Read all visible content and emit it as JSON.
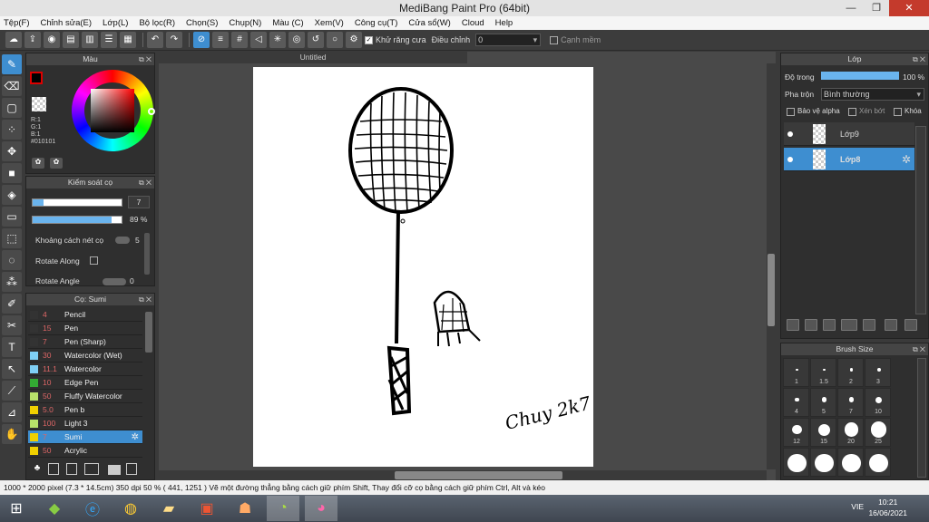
{
  "window": {
    "title": "MediBang Paint Pro (64bit)",
    "min": "—",
    "max": "❐",
    "close": "✕"
  },
  "menu": [
    "Tệp(F)",
    "Chỉnh sửa(E)",
    "Lớp(L)",
    "Bộ lọc(R)",
    "Chọn(S)",
    "Chụp(N)",
    "Màu (C)",
    "Xem(V)",
    "Công cụ(T)",
    "Cửa sổ(W)",
    "Cloud",
    "Help"
  ],
  "toolbar": {
    "antialias_label": "Khử răng cưa",
    "adjust_label": "Điều chỉnh",
    "adjust_value": "0",
    "smooth_label": "Cạnh mềm"
  },
  "color_panel": {
    "title": "Màu",
    "r": "R:1",
    "g": "G:1",
    "b": "B:1",
    "hex": "#010101"
  },
  "brush_control": {
    "title": "Kiểm soát cọ",
    "size_value": "7",
    "opacity_value": "89 %",
    "opacity_fraction": 0.89,
    "spacing_label": "Khoảng cách nét cọ",
    "spacing_value": "5",
    "rotate_along_label": "Rotate Along",
    "rotate_angle_label": "Rotate Angle",
    "rotate_angle_value": "0"
  },
  "brush_list": {
    "title": "Cọ: Sumi",
    "items": [
      {
        "size": "4",
        "name": "Pencil",
        "color": "#333333"
      },
      {
        "size": "15",
        "name": "Pen",
        "color": "#333333"
      },
      {
        "size": "7",
        "name": "Pen (Sharp)",
        "color": "#333333"
      },
      {
        "size": "30",
        "name": "Watercolor (Wet)",
        "color": "#7fd0f5"
      },
      {
        "size": "11.1",
        "name": "Watercolor",
        "color": "#7fd0f5"
      },
      {
        "size": "10",
        "name": "Edge Pen",
        "color": "#33aa33"
      },
      {
        "size": "50",
        "name": "Fluffy Watercolor",
        "color": "#b8e26a"
      },
      {
        "size": "5.0",
        "name": "Pen b",
        "color": "#f0d000"
      },
      {
        "size": "100",
        "name": "Light 3",
        "color": "#b8e26a"
      },
      {
        "size": "7",
        "name": "Sumi",
        "color": "#f0d000"
      },
      {
        "size": "50",
        "name": "Acrylic",
        "color": "#f0d000"
      }
    ]
  },
  "canvas": {
    "tab": "Untitled",
    "signature": "Chuy 2k7"
  },
  "layer_panel": {
    "title": "Lớp",
    "opacity_label": "Độ trong",
    "opacity_value": "100 %",
    "blend_label": "Pha trộn",
    "blend_value": "Bình thường",
    "protect_alpha": "Bảo vệ alpha",
    "clip": "Xén bớt",
    "lock": "Khóa",
    "layers": [
      {
        "name": "Lớp9"
      },
      {
        "name": "Lớp8"
      }
    ]
  },
  "brush_size": {
    "title": "Brush Size",
    "sizes": [
      "1",
      "1.5",
      "2",
      "3",
      "4",
      "5",
      "7",
      "10",
      "12",
      "15",
      "20",
      "25",
      "",
      "",
      "",
      ""
    ]
  },
  "status": {
    "text": "1000 * 2000 pixel   (7.3 * 14.5cm)   350 dpi   50 %   ( 441, 1251 )   Vẽ một đường thẳng bằng cách giữ phím Shift, Thay đổi cỡ cọ bằng cách giữ phím Ctrl, Alt và kéo"
  },
  "taskbar": {
    "lang": "VIE",
    "time": "10:21",
    "date": "16/06/2021"
  }
}
